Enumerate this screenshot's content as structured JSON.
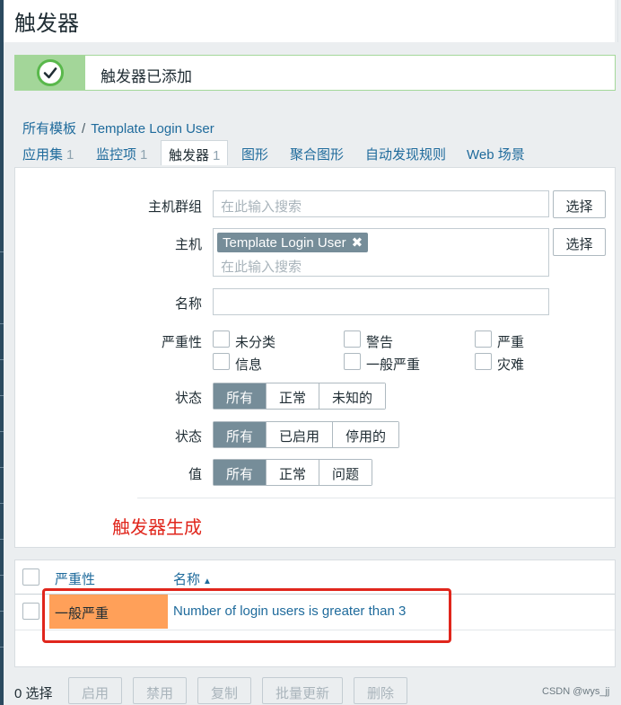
{
  "page": {
    "title": "触发器"
  },
  "message": {
    "text": "触发器已添加",
    "icon": "check-icon"
  },
  "breadcrumb": {
    "root": "所有模板",
    "separator": "/",
    "current": "Template Login User"
  },
  "tabs": [
    {
      "label": "应用集",
      "count": "1"
    },
    {
      "label": "监控项",
      "count": "1"
    },
    {
      "label": "触发器",
      "count": "1"
    },
    {
      "label": "图形"
    },
    {
      "label": "聚合图形"
    },
    {
      "label": "自动发现规则"
    },
    {
      "label": "Web 场景"
    }
  ],
  "filter": {
    "host_group": {
      "label": "主机群组",
      "placeholder": "在此输入搜索",
      "button": "选择"
    },
    "host": {
      "label": "主机",
      "tag": "Template Login User",
      "placeholder": "在此输入搜索",
      "button": "选择"
    },
    "name": {
      "label": "名称",
      "value": ""
    },
    "severity": {
      "label": "严重性",
      "options": [
        "未分类",
        "警告",
        "严重",
        "信息",
        "一般严重",
        "灾难"
      ]
    },
    "state": {
      "label": "状态",
      "options": [
        "所有",
        "正常",
        "未知的"
      ],
      "selected": "所有"
    },
    "status": {
      "label": "状态",
      "options": [
        "所有",
        "已启用",
        "停用的"
      ],
      "selected": "所有"
    },
    "value": {
      "label": "值",
      "options": [
        "所有",
        "正常",
        "问题"
      ],
      "selected": "所有"
    }
  },
  "annotation": "触发器生成",
  "table": {
    "headers": {
      "severity": "严重性",
      "name": "名称"
    },
    "rows": [
      {
        "severity": "一般严重",
        "name": "Number of login users is greater than 3",
        "severity_color": "#ffa059"
      }
    ]
  },
  "footer": {
    "selected": "0 选择",
    "buttons": [
      "启用",
      "禁用",
      "复制",
      "批量更新",
      "删除"
    ],
    "watermark": "CSDN @wys_jj"
  },
  "colors": {
    "accent": "#1f6b9c",
    "success": "#59b84b",
    "annotation_red": "#e0261c",
    "tag_bg": "#768d99"
  }
}
